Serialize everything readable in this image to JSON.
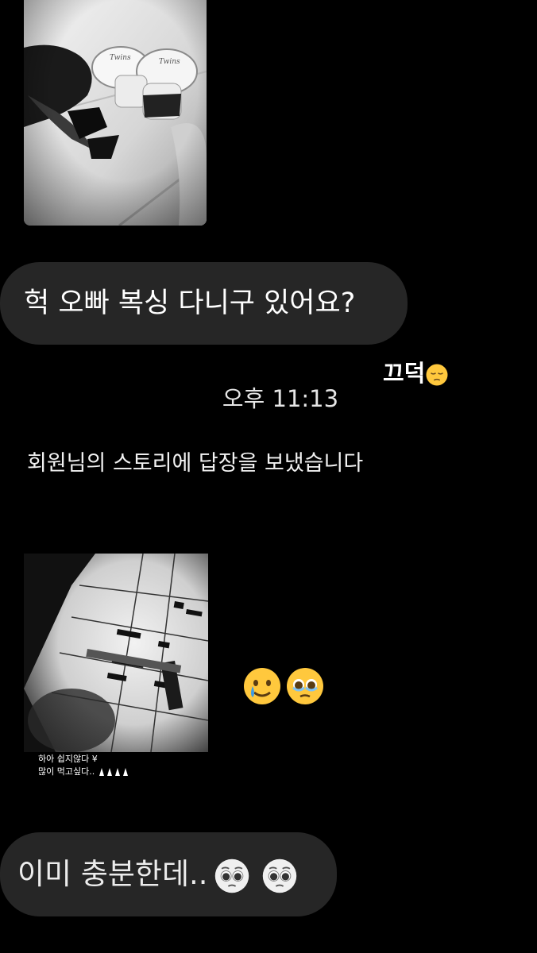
{
  "messages": {
    "received_1": "헉 오빠 복싱 다니구 있어요?",
    "sent_1": "끄덕",
    "timestamp": "오후 11:13",
    "story_reply_label": "회원님의 스토리에 답장을 보냈습니다",
    "story_caption_line_1": "하아 쉽지않다 ¥",
    "story_caption_line_2": "많이 먹고싶다..",
    "received_2": "이미 충분한데.."
  },
  "icons": {
    "sent_1_emoji": "pensive-face-icon",
    "reaction_1": "crying-smile-face-icon",
    "reaction_2": "face-holding-back-tears-icon",
    "received_2_emoji_1": "pleading-face-icon",
    "received_2_emoji_2": "pleading-face-icon",
    "story_caption_emoji": "folded-hands-icon"
  },
  "colors": {
    "background": "#000000",
    "received_bubble": "#262626",
    "emoji_yellow": "#ffc83d"
  }
}
